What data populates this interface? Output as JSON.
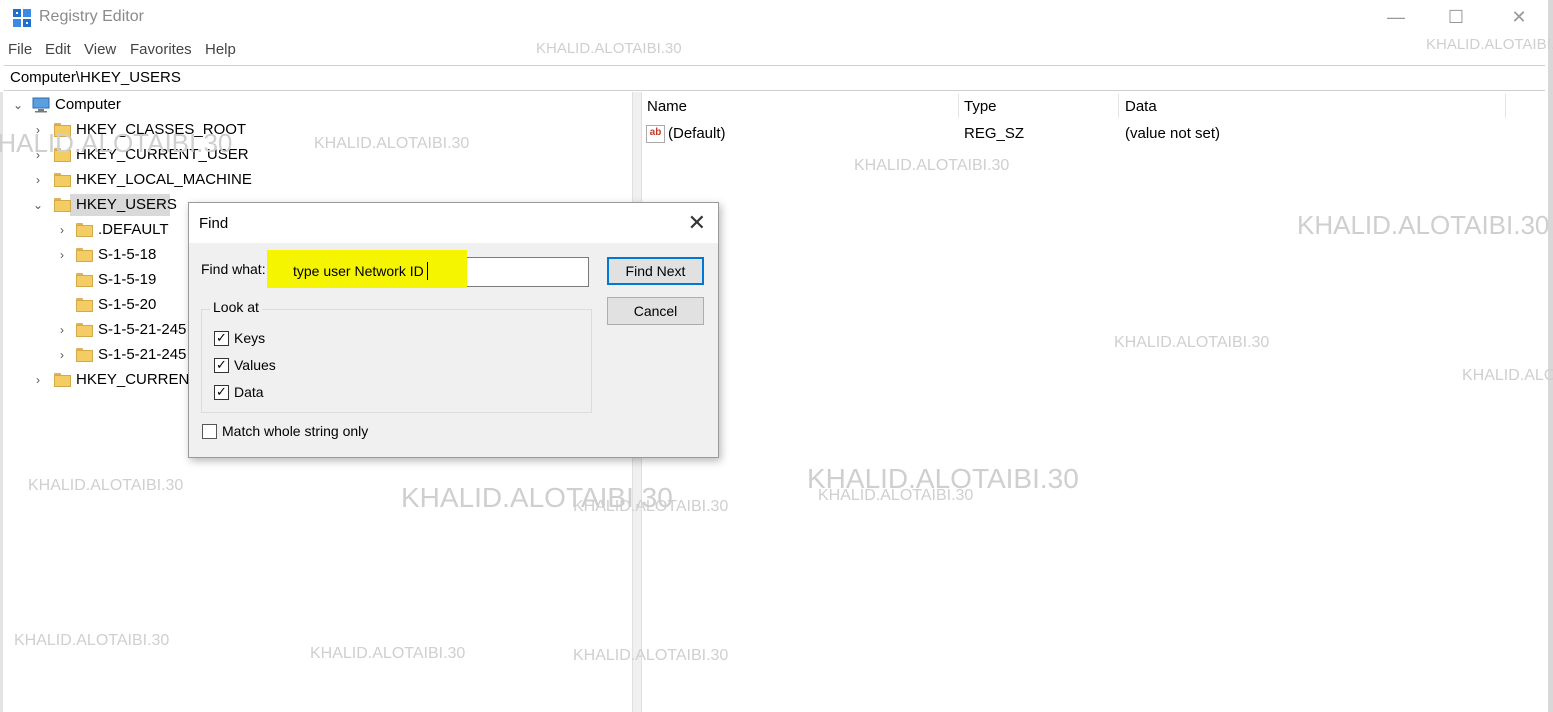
{
  "window": {
    "title": "Registry Editor",
    "controls": [
      "—",
      "☐",
      "✕"
    ]
  },
  "menu": [
    "File",
    "Edit",
    "View",
    "Favorites",
    "Help"
  ],
  "address": "Computer\\HKEY_USERS",
  "tree": {
    "root": "Computer",
    "items": [
      {
        "label": "HKEY_CLASSES_ROOT",
        "expander": "›"
      },
      {
        "label": "HKEY_CURRENT_USER",
        "expander": "›"
      },
      {
        "label": "HKEY_LOCAL_MACHINE",
        "expander": "›"
      },
      {
        "label": "HKEY_USERS",
        "expander": "⌄",
        "selected": true
      },
      {
        "label": ".DEFAULT",
        "expander": "›"
      },
      {
        "label": "S-1-5-18",
        "expander": "›"
      },
      {
        "label": "S-1-5-19",
        "expander": ""
      },
      {
        "label": "S-1-5-20",
        "expander": ""
      },
      {
        "label": "S-1-5-21-245",
        "expander": "›"
      },
      {
        "label": "S-1-5-21-245",
        "expander": "›"
      },
      {
        "label": "HKEY_CURRENT",
        "expander": "›"
      }
    ]
  },
  "list": {
    "columns": [
      "Name",
      "Type",
      "Data"
    ],
    "rows": [
      {
        "icon": "ab",
        "name": "(Default)",
        "type": "REG_SZ",
        "data": "(value not set)"
      }
    ]
  },
  "find_dialog": {
    "title": "Find",
    "close_glyph": "✕",
    "find_what_label": "Find what:",
    "find_what_value": "type user Network ID",
    "find_next": "Find Next",
    "cancel": "Cancel",
    "look_at_label": "Look at",
    "keys": "Keys",
    "values": "Values",
    "data": "Data",
    "keys_checked": true,
    "values_checked": true,
    "data_checked": true,
    "match_whole": "Match whole string only",
    "match_whole_checked": false,
    "check_glyph": "✓"
  },
  "watermark": "KHALID.ALOTAIBI.30",
  "colors": {
    "highlight": "#f5f500",
    "selection": "#d9d9d9",
    "accent": "#0078d7"
  }
}
